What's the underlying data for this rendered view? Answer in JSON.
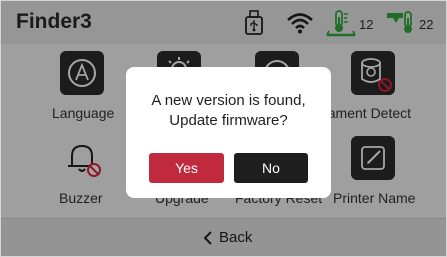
{
  "header": {
    "title": "Finder3",
    "icons": [
      "usb-icon",
      "wifi-icon",
      "bed-temp-icon",
      "nozzle-temp-icon"
    ],
    "bed_temp": "12",
    "nozzle_temp": "22",
    "colors": {
      "bed_temp_icon": "#2eaa3c",
      "nozzle_temp_icon": "#2eaa3c"
    }
  },
  "menu": {
    "items": [
      {
        "label": "Language",
        "icon": "language-icon"
      },
      {
        "label": "Upgrade",
        "icon": "upgrade-icon"
      },
      {
        "label": "Factory Reset",
        "icon": "factory-reset-icon"
      },
      {
        "label": "Filament Detect",
        "icon": "filament-detect-icon"
      },
      {
        "label": "Buzzer",
        "icon": "buzzer-icon"
      },
      {
        "label": "Printer Name",
        "icon": "printer-name-icon"
      }
    ]
  },
  "footer": {
    "back_label": "Back"
  },
  "dialog": {
    "line1": "A new version is found,",
    "line2": "Update firmware?",
    "yes_label": "Yes",
    "no_label": "No",
    "colors": {
      "yes": "#c0293e",
      "no": "#1f1f1f"
    }
  }
}
